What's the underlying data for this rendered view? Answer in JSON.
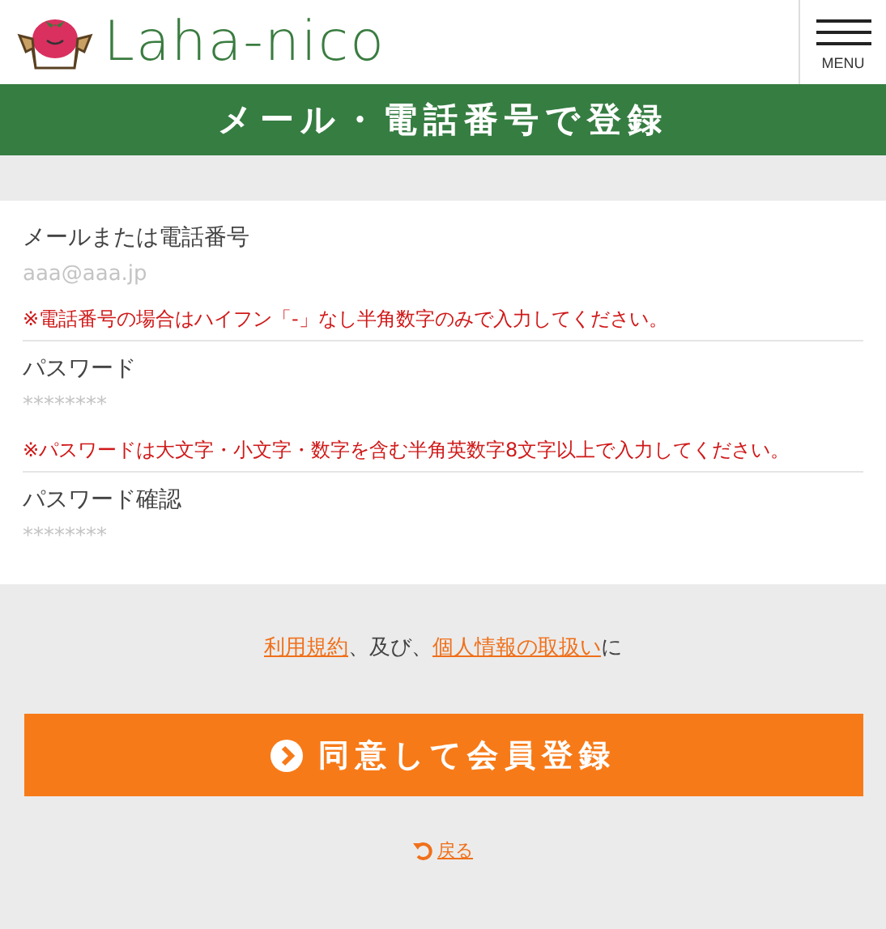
{
  "header": {
    "logo_text": "Laha-nico",
    "menu_label": "MENU"
  },
  "title": "メール・電話番号で登録",
  "fields": [
    {
      "label": "メールまたは電話番号",
      "placeholder": "aaa@aaa.jp",
      "note": "※電話番号の場合はハイフン「-」なし半角数字のみで入力してください。"
    },
    {
      "label": "パスワード",
      "placeholder": "********",
      "note": "※パスワードは大文字・小文字・数字を含む半角英数字8文字以上で入力してください。"
    },
    {
      "label": "パスワード確認",
      "placeholder": "********"
    }
  ],
  "agreement": [
    {
      "kind": "link",
      "text": "利用規約"
    },
    {
      "kind": "text",
      "text": "、及び、"
    },
    {
      "kind": "link",
      "text": "個人情報の取扱い"
    },
    {
      "kind": "text",
      "text": "に"
    }
  ],
  "submit_button": "同意して会員登録",
  "back_link": "戻る"
}
